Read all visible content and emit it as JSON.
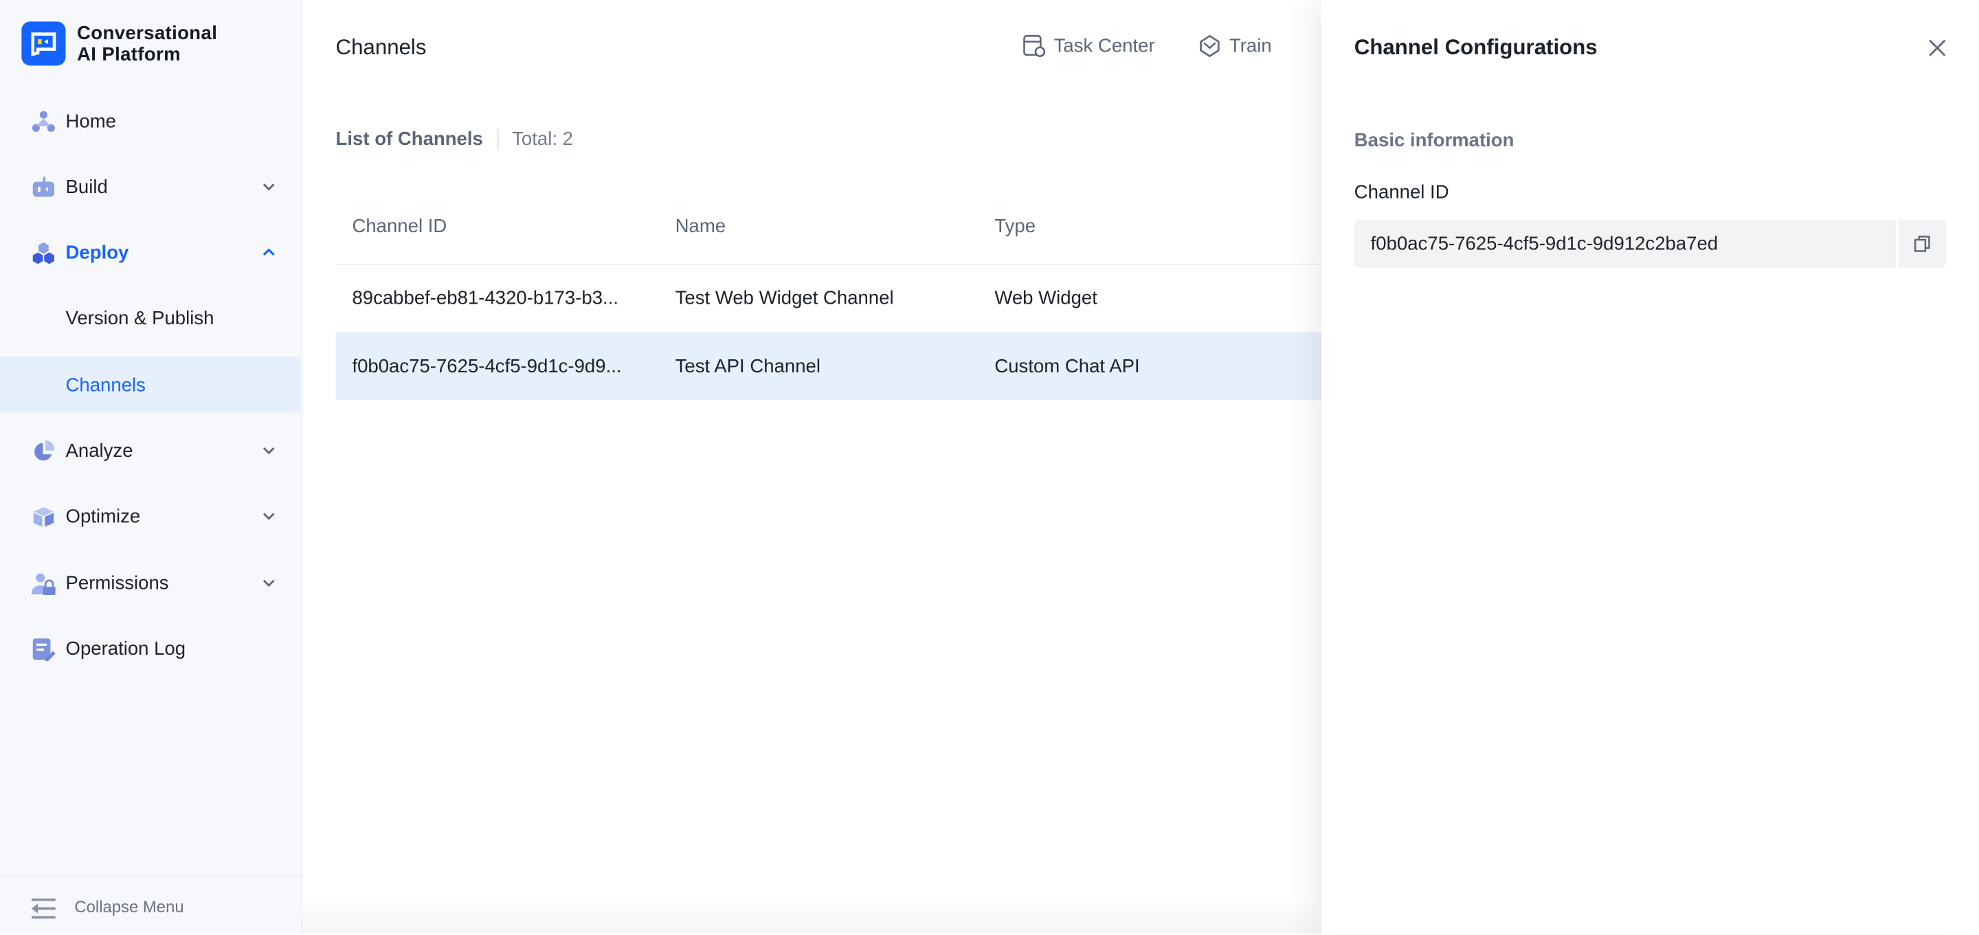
{
  "app": {
    "title_line1": "Conversational",
    "title_line2": "AI Platform",
    "brand_color": "#1664ff"
  },
  "sidebar": {
    "items": [
      {
        "label": "Home",
        "icon": "home-icon"
      },
      {
        "label": "Build",
        "icon": "robot-icon",
        "expandable": true
      },
      {
        "label": "Deploy",
        "icon": "cubes-icon",
        "expandable": true,
        "expanded": true,
        "active": true
      },
      {
        "label": "Version & Publish",
        "sub": true
      },
      {
        "label": "Channels",
        "sub": true,
        "selected": true
      },
      {
        "label": "Analyze",
        "icon": "pie-chart-icon",
        "expandable": true
      },
      {
        "label": "Optimize",
        "icon": "box-icon",
        "expandable": true
      },
      {
        "label": "Permissions",
        "icon": "user-lock-icon",
        "expandable": true
      },
      {
        "label": "Operation Log",
        "icon": "log-edit-icon"
      }
    ],
    "collapse_label": "Collapse Menu"
  },
  "header": {
    "title": "Channels",
    "actions": [
      {
        "label": "Task Center",
        "icon": "task-center-icon"
      },
      {
        "label": "Train",
        "icon": "train-icon"
      }
    ]
  },
  "list": {
    "title": "List of Channels",
    "total": "Total: 2",
    "columns": [
      "Channel ID",
      "Name",
      "Type"
    ],
    "rows": [
      {
        "id": "89cabbef-eb81-4320-b173-b3...",
        "name": "Test Web Widget Channel",
        "type": "Web Widget"
      },
      {
        "id": "f0b0ac75-7625-4cf5-9d1c-9d9...",
        "name": "Test API Channel",
        "type": "Custom Chat API",
        "selected": true
      }
    ]
  },
  "drawer": {
    "title": "Channel Configurations",
    "section": "Basic information",
    "field_label": "Channel ID",
    "field_value": "f0b0ac75-7625-4cf5-9d1c-9d912c2ba7ed"
  }
}
